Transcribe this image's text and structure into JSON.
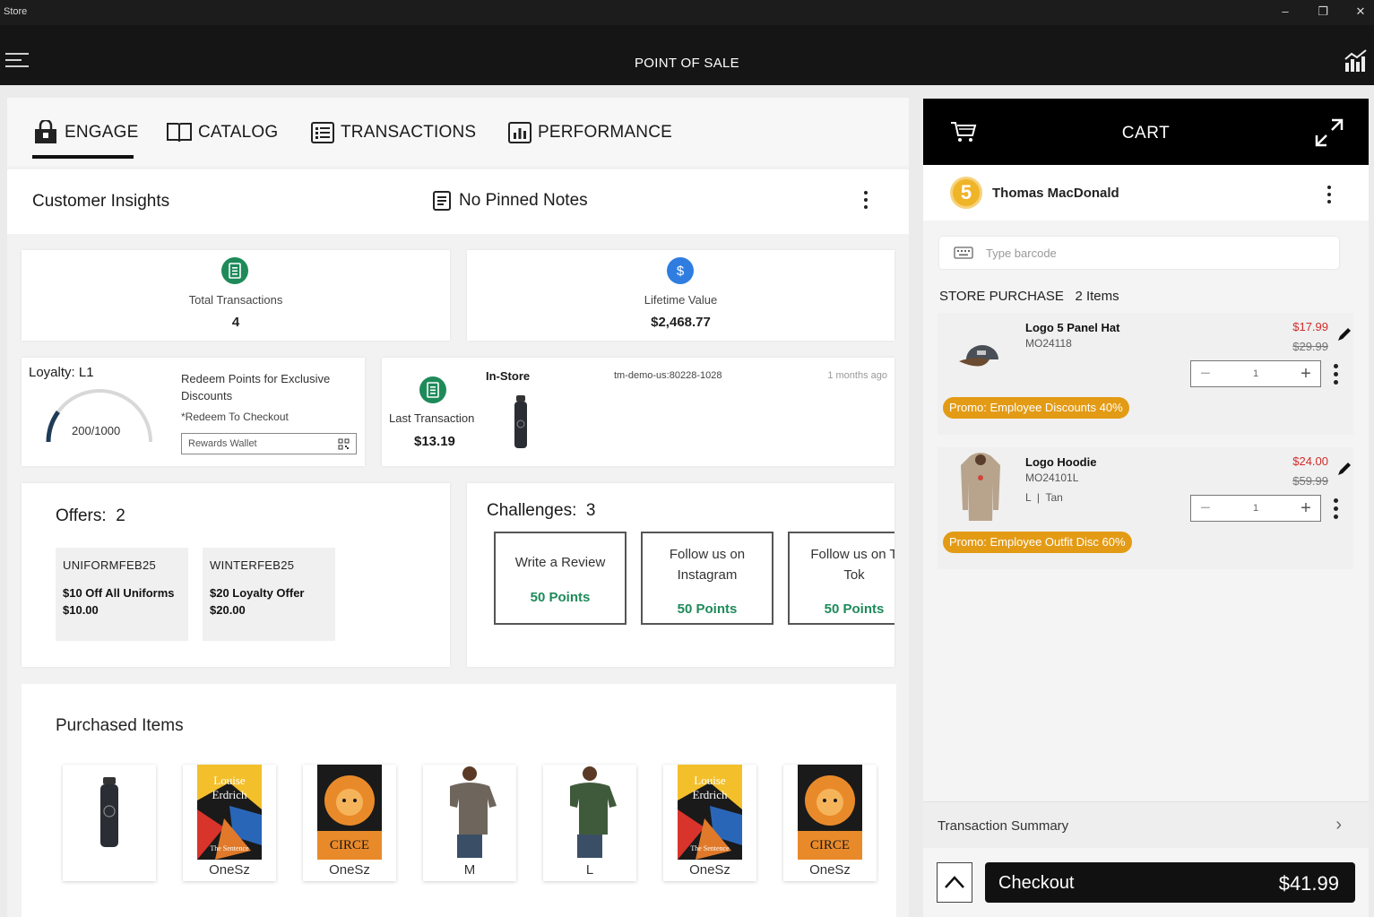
{
  "window": {
    "title": "Store",
    "minimize": "–",
    "restore": "❐",
    "close": "✕"
  },
  "header": {
    "title": "POINT OF SALE"
  },
  "tabs": [
    {
      "label": "ENGAGE",
      "icon": "bag-icon"
    },
    {
      "label": "CATALOG",
      "icon": "book-icon"
    },
    {
      "label": "TRANSACTIONS",
      "icon": "list-icon"
    },
    {
      "label": "PERFORMANCE",
      "icon": "bar-chart-icon"
    }
  ],
  "insights": {
    "title": "Customer Insights",
    "notes": "No Pinned Notes"
  },
  "stats": {
    "total_transactions_label": "Total Transactions",
    "total_transactions_value": "4",
    "lifetime_value_label": "Lifetime Value",
    "lifetime_value_value": "$2,468.77"
  },
  "loyalty": {
    "title": "Loyalty: L1",
    "points": "200/1000",
    "points_fraction": 0.2,
    "redeem_text": "Redeem Points for Exclusive Discounts",
    "redeem_note": "*Redeem To Checkout",
    "wallet_label": "Rewards Wallet"
  },
  "last_transaction": {
    "label": "Last Transaction",
    "amount": "$13.19",
    "channel": "In-Store",
    "store_id": "tm-demo-us:80228-1028",
    "time": "1 months ago"
  },
  "offers": {
    "title": "Offers:",
    "count": "2",
    "items": [
      {
        "code": "UNIFORMFEB25",
        "desc": "$10 Off All Uniforms",
        "amount": "$10.00"
      },
      {
        "code": "WINTERFEB25",
        "desc": "$20 Loyalty Offer",
        "amount": "$20.00"
      }
    ]
  },
  "challenges": {
    "title": "Challenges:",
    "count": "3",
    "items": [
      {
        "line1": "Write a Review",
        "line2": "",
        "points": "50 Points"
      },
      {
        "line1": "Follow us on",
        "line2": "Instagram",
        "points": "50 Points"
      },
      {
        "line1": "Follow us on T",
        "line2": "Tok",
        "points": "50 Points"
      }
    ]
  },
  "purchased": {
    "title": "Purchased Items",
    "items": [
      {
        "kind": "bottle",
        "size": ""
      },
      {
        "kind": "book-sentence",
        "size": "OneSz"
      },
      {
        "kind": "book-circe",
        "size": "OneSz"
      },
      {
        "kind": "tshirt-brown",
        "size": "M"
      },
      {
        "kind": "tshirt-green",
        "size": "L"
      },
      {
        "kind": "book-sentence",
        "size": "OneSz"
      },
      {
        "kind": "book-circe",
        "size": "OneSz"
      }
    ],
    "book_sentence_text": "Louise Erdrich",
    "book_sentence_sub": "The Sentence",
    "book_circe_text": "CIRCE"
  },
  "cart": {
    "title": "CART",
    "customer_name": "Thomas MacDonald",
    "customer_badge": "5",
    "barcode_placeholder": "Type barcode",
    "section_title": "STORE PURCHASE",
    "item_count": "2 Items",
    "items": [
      {
        "name": "Logo 5 Panel Hat",
        "sku": "MO24118",
        "variant": "",
        "price": "$17.99",
        "orig_price": "$29.99",
        "qty": "1",
        "promo": "Promo: Employee Discounts 40%"
      },
      {
        "name": "Logo Hoodie",
        "sku": "MO24101L",
        "variant": "L  |  Tan",
        "price": "$24.00",
        "orig_price": "$59.99",
        "qty": "1",
        "promo": "Promo: Employee Outfit Disc 60%"
      }
    ],
    "summary_label": "Transaction Summary",
    "checkout_label": "Checkout",
    "checkout_amount": "$41.99"
  },
  "colors": {
    "accent_green": "#1e8a5a",
    "promo_orange": "#e39b15",
    "price_red": "#d12b2b",
    "gold": "#f0b429",
    "blue": "#2f7de1"
  }
}
